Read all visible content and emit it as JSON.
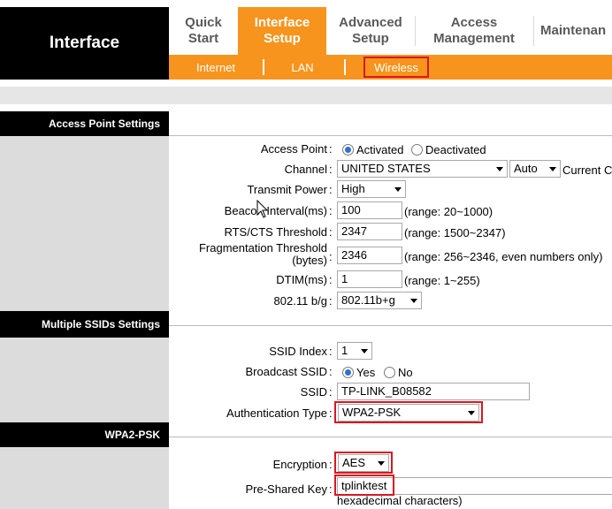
{
  "brand": "Interface",
  "nav": {
    "tabs": [
      {
        "line1": "Quick",
        "line2": "Start"
      },
      {
        "line1": "Interface",
        "line2": "Setup"
      },
      {
        "line1": "Advanced",
        "line2": "Setup"
      },
      {
        "line1": "Access",
        "line2": "Management"
      },
      {
        "line1": "Maintenan",
        "line2": ""
      }
    ],
    "subtabs": [
      "Internet",
      "LAN",
      "Wireless"
    ]
  },
  "sections": {
    "ap": "Access Point Settings",
    "ssid": "Multiple SSIDs Settings",
    "wpa": "WPA2-PSK"
  },
  "ap": {
    "access_point_label": "Access Point",
    "activated": "Activated",
    "deactivated": "Deactivated",
    "channel_label": "Channel",
    "channel_region": "UNITED STATES",
    "channel_value": "Auto",
    "current_channel": "Current C",
    "tx_power_label": "Transmit Power",
    "tx_power_value": "High",
    "beacon_label": "Beacon Interval(ms)",
    "beacon_value": "100",
    "beacon_hint": "(range: 20~1000)",
    "rts_label": "RTS/CTS Threshold",
    "rts_value": "2347",
    "rts_hint": "(range: 1500~2347)",
    "frag_label_1": "Fragmentation Threshold",
    "frag_label_2": "(bytes)",
    "frag_value": "2346",
    "frag_hint": "(range: 256~2346, even numbers only)",
    "dtim_label": "DTIM(ms)",
    "dtim_value": "1",
    "dtim_hint": "(range: 1~255)",
    "mode_label": "802.11 b/g",
    "mode_value": "802.11b+g"
  },
  "ssid": {
    "index_label": "SSID Index",
    "index_value": "1",
    "broadcast_label": "Broadcast SSID",
    "yes": "Yes",
    "no": "No",
    "ssid_label": "SSID",
    "ssid_value": "TP-LINK_B08582",
    "auth_label": "Authentication Type",
    "auth_value": "WPA2-PSK"
  },
  "wpa": {
    "encryption_label": "Encryption",
    "encryption_value": "AES",
    "psk_label": "Pre-Shared Key",
    "psk_value": "tplinktest",
    "psk_hint": "hexadecimal characters)"
  },
  "colors": {
    "orange": "#f7941d",
    "highlight": "#d71920",
    "section_bg": "#000000",
    "side_gray": "#dcdcdc"
  }
}
